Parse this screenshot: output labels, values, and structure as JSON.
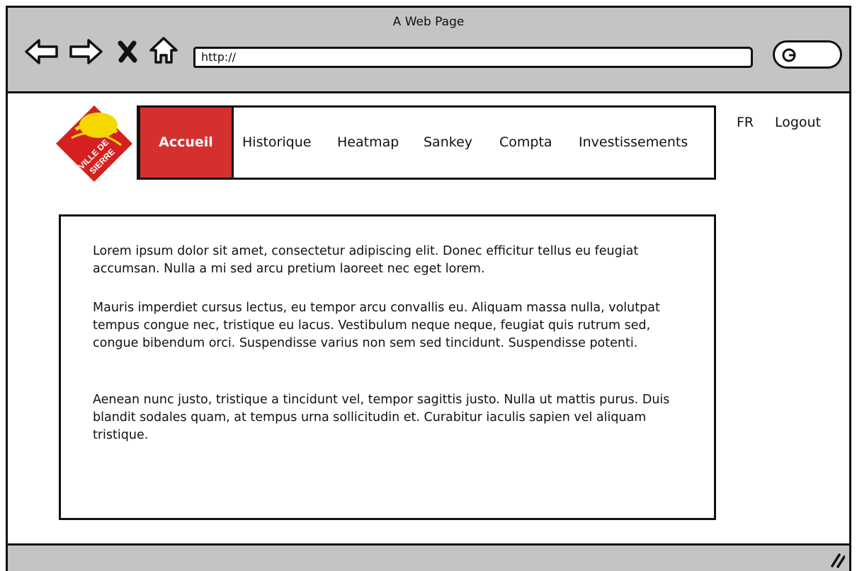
{
  "window": {
    "title": "A Web Page"
  },
  "toolbar": {
    "back_icon": "back-arrow-icon",
    "forward_icon": "forward-arrow-icon",
    "stop_icon": "close-icon",
    "home_icon": "home-icon",
    "url": "http://",
    "search_icon": "search-icon"
  },
  "logo": {
    "line1": "VILLE DE",
    "line2": "SIERRE",
    "colors": {
      "red": "#d42020",
      "yellow": "#f5d800"
    }
  },
  "nav": {
    "items": [
      {
        "label": "Accueil",
        "active": true
      },
      {
        "label": "Historique",
        "active": false
      },
      {
        "label": "Heatmap",
        "active": false
      },
      {
        "label": "Sankey",
        "active": false
      },
      {
        "label": "Compta",
        "active": false
      },
      {
        "label": "Investissements",
        "active": false
      }
    ],
    "active_color": "#d43030"
  },
  "header_links": {
    "language": "FR",
    "logout": "Logout"
  },
  "content": {
    "paragraphs": [
      "Lorem ipsum dolor sit amet, consectetur adipiscing elit. Donec efficitur tellus eu feugiat accumsan. Nulla a mi sed arcu pretium laoreet nec eget lorem.",
      "Mauris imperdiet cursus lectus, eu tempor arcu convallis eu. Aliquam massa nulla, volutpat tempus congue nec, tristique eu lacus. Vestibulum neque neque, feugiat quis rutrum sed, congue bibendum orci. Suspendisse varius non sem sed tincidunt. Suspendisse potenti.",
      "Aenean nunc justo, tristique a tincidunt vel, tempor sagittis justo. Nulla ut mattis purus. Duis blandit sodales quam, at tempus urna sollicitudin et. Curabitur iaculis sapien vel aliquam tristique."
    ]
  },
  "statusbar": {
    "resize_icon": "resize-grip-icon"
  },
  "colors": {
    "chrome": "#c4c4c4",
    "ink": "#111111"
  }
}
